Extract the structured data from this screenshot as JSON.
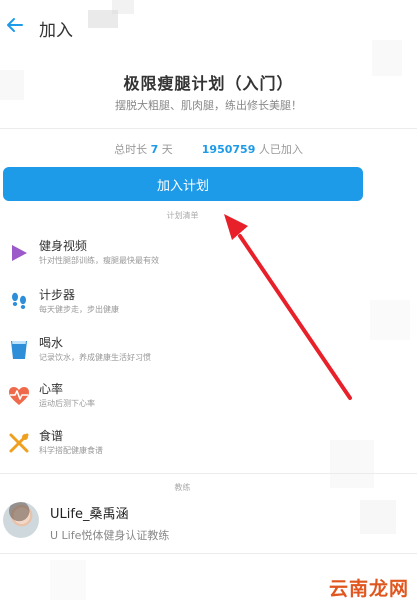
{
  "header": {
    "title": "加入"
  },
  "plan": {
    "title": "极限瘦腿计划（入门）",
    "subtitle": "摆脱大粗腿、肌肉腿，练出修长美腿！",
    "duration_label": "总时长",
    "duration_value": "7",
    "duration_unit": "天",
    "joined_count": "1950759",
    "joined_suffix": "人已加入",
    "join_button": "加入计划"
  },
  "list": {
    "header": "计划清单",
    "items": [
      {
        "title": "健身视频",
        "desc": "针对性腿部训练，瘦腿最快最有效",
        "icon": "play-icon"
      },
      {
        "title": "计步器",
        "desc": "每天健步走，步出健康",
        "icon": "footprints-icon"
      },
      {
        "title": "喝水",
        "desc": "记录饮水，养成健康生活好习惯",
        "icon": "water-cup-icon"
      },
      {
        "title": "心率",
        "desc": "运动后测下心率",
        "icon": "heart-rate-icon"
      },
      {
        "title": "食谱",
        "desc": "科学搭配健康食谱",
        "icon": "fork-spoon-icon"
      }
    ]
  },
  "coach": {
    "header": "教练",
    "name": "ULife_桑禹涵",
    "desc": "U Life悦体健身认证教练"
  },
  "colors": {
    "accent": "#1e9be8",
    "annotation_arrow": "#e8202a"
  },
  "watermark": "云南龙网"
}
